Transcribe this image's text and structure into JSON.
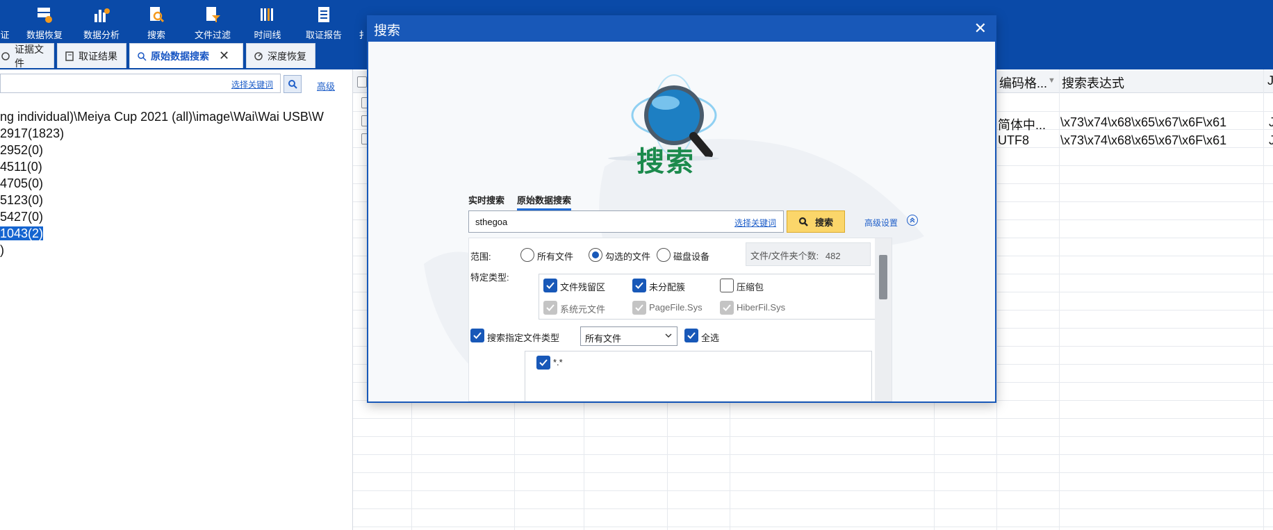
{
  "toolbar": {
    "partial_left": "证",
    "items": [
      {
        "label": "数据恢复",
        "icon": "data-recovery-icon"
      },
      {
        "label": "数据分析",
        "icon": "data-analysis-icon"
      },
      {
        "label": "搜索",
        "icon": "search-doc-icon"
      },
      {
        "label": "文件过滤",
        "icon": "file-filter-icon"
      },
      {
        "label": "时间线",
        "icon": "timeline-icon"
      },
      {
        "label": "取证报告",
        "icon": "report-icon"
      },
      {
        "label": "扌",
        "icon": "partial-tool-icon"
      }
    ]
  },
  "tabs": [
    {
      "label": "证据文件",
      "icon": "evidence-icon"
    },
    {
      "label": "取证结果",
      "icon": "result-icon"
    },
    {
      "label": "原始数据搜索",
      "icon": "raw-search-icon",
      "active": true,
      "close": "✕"
    },
    {
      "label": "深度恢复",
      "icon": "deep-recovery-icon"
    }
  ],
  "left": {
    "keyword_link": "选择关键词",
    "advanced_link": "高级",
    "tree": [
      "ng individual)\\Meiya Cup 2021 (all)\\image\\Wai\\Wai USB\\W",
      "2917(1823)",
      "2952(0)",
      "4511(0)",
      "4705(0)",
      "5123(0)",
      "5427(0)",
      "1043(2)",
      ")"
    ],
    "selected_index": 7
  },
  "grid": {
    "headers": {
      "encoding": "编码格...",
      "expression": "搜索表达式",
      "last": "J"
    },
    "rows": [
      {
        "encoding": "简体中...",
        "expression": "\\x73\\x74\\x68\\x65\\x67\\x6F\\x61",
        "last": "J"
      },
      {
        "encoding": "UTF8",
        "expression": "\\x73\\x74\\x68\\x65\\x67\\x6F\\x61",
        "last": "J"
      }
    ]
  },
  "dialog": {
    "title": "搜索",
    "close": "✕",
    "logo_text": "搜索",
    "modes": [
      "实时搜索",
      "原始数据搜索"
    ],
    "active_mode": 1,
    "search_value": "sthegoa",
    "keyword_link": "选择关键词",
    "search_button": "搜索",
    "advanced_settings": "高级设置",
    "scope_label": "范围:",
    "scope_options": [
      "所有文件",
      "勾选的文件",
      "磁盘设备"
    ],
    "scope_selected": 1,
    "count_label": "文件/文件夹个数:",
    "count_value": "482",
    "types_label": "特定类型:",
    "types": [
      {
        "label": "文件残留区",
        "state": "on"
      },
      {
        "label": "未分配簇",
        "state": "on"
      },
      {
        "label": "压缩包",
        "state": "off"
      },
      {
        "label": "系统元文件",
        "state": "dis"
      },
      {
        "label": "PageFile.Sys",
        "state": "dis"
      },
      {
        "label": "HiberFil.Sys",
        "state": "dis"
      }
    ],
    "filetype_check_label": "搜索指定文件类型",
    "filetype_select": "所有文件",
    "select_all_label": "全选",
    "filetype_items": [
      "*.*"
    ]
  }
}
